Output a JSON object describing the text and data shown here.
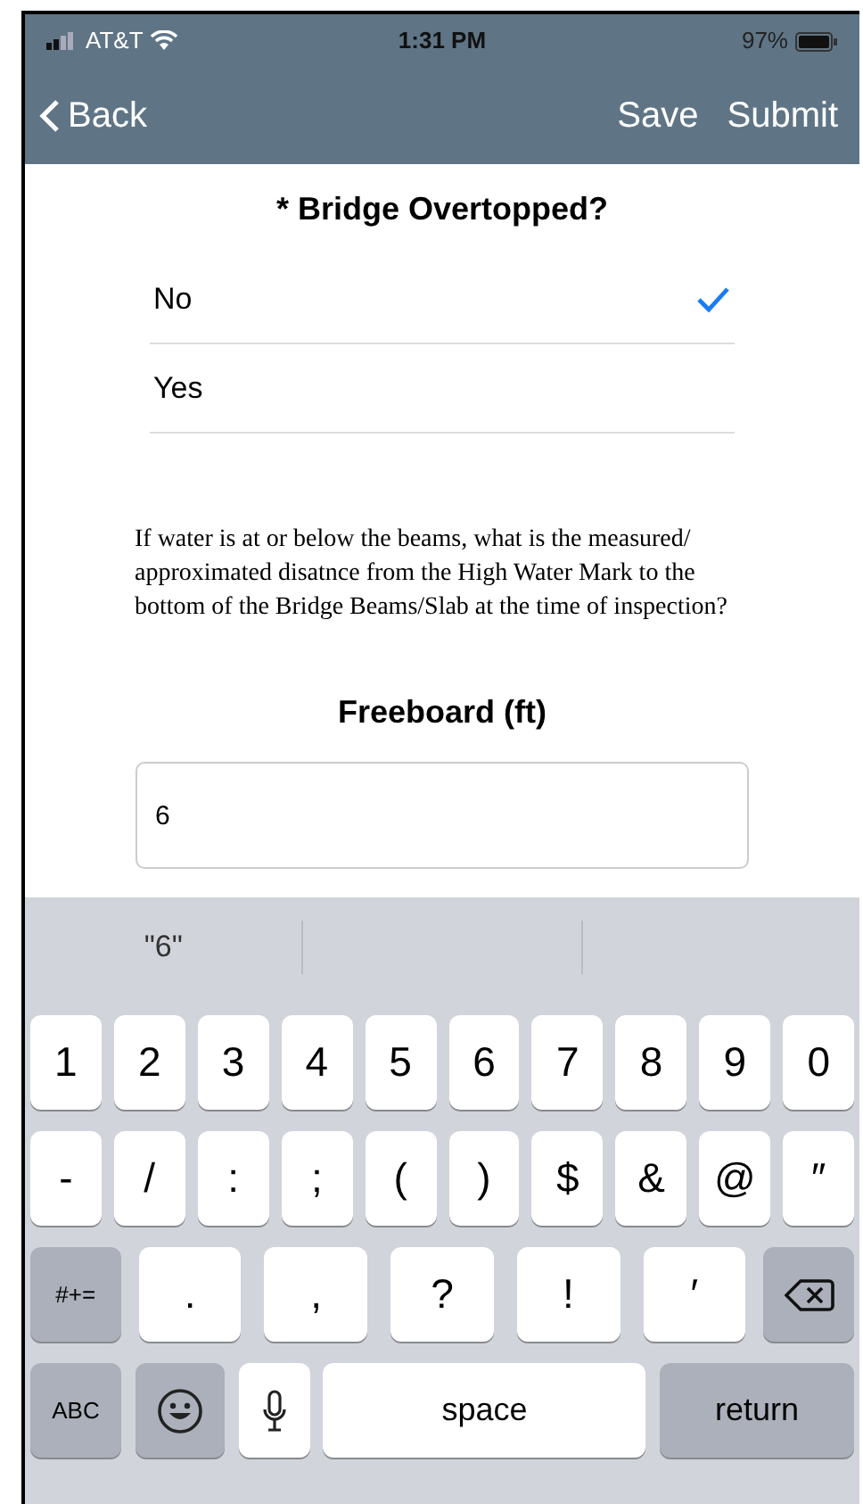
{
  "status_bar": {
    "carrier": "AT&T",
    "time": "1:31 PM",
    "battery": "97%"
  },
  "nav": {
    "back": "Back",
    "actions": [
      "Save",
      "Submit"
    ]
  },
  "question": {
    "title": "* Bridge Overtopped?",
    "options": [
      {
        "label": "No",
        "selected": true
      },
      {
        "label": "Yes",
        "selected": false
      }
    ]
  },
  "help_text": "If water is at or below the beams, what is the measured/ approximated disatnce from the High Water Mark to the bottom of the Bridge Beams/Slab at the time of inspection?",
  "field": {
    "label": "Freeboard (ft)",
    "value": "6"
  },
  "keyboard": {
    "suggestions": [
      "\"6\""
    ],
    "number_row": [
      {
        "kind": "char",
        "label": "1"
      },
      {
        "kind": "char",
        "label": "2"
      },
      {
        "kind": "char",
        "label": "3"
      },
      {
        "kind": "char",
        "label": "4"
      },
      {
        "kind": "char",
        "label": "5"
      },
      {
        "kind": "char",
        "label": "6"
      },
      {
        "kind": "char",
        "label": "7"
      },
      {
        "kind": "char",
        "label": "8"
      },
      {
        "kind": "char",
        "label": "9"
      },
      {
        "kind": "char",
        "label": "0"
      }
    ],
    "symbol_row": [
      {
        "kind": "char",
        "label": "-"
      },
      {
        "kind": "char",
        "label": "/"
      },
      {
        "kind": "char",
        "label": ":"
      },
      {
        "kind": "char",
        "label": ";"
      },
      {
        "kind": "char",
        "label": "("
      },
      {
        "kind": "char",
        "label": ")"
      },
      {
        "kind": "char",
        "label": "$"
      },
      {
        "kind": "char",
        "label": "&"
      },
      {
        "kind": "char",
        "label": "@"
      },
      {
        "kind": "char",
        "label": "″"
      }
    ],
    "punctuation_row": [
      {
        "kind": "function",
        "label": "#+="
      },
      {
        "kind": "wide",
        "label": "."
      },
      {
        "kind": "wide",
        "label": ","
      },
      {
        "kind": "wide",
        "label": "?"
      },
      {
        "kind": "wide",
        "label": "!"
      },
      {
        "kind": "wide",
        "label": "′"
      },
      {
        "kind": "delete"
      }
    ],
    "bottom_row": [
      {
        "kind": "function",
        "label": "ABC"
      },
      {
        "kind": "emoji"
      },
      {
        "kind": "mic"
      },
      {
        "kind": "space",
        "label": "space"
      },
      {
        "kind": "return",
        "label": "return"
      }
    ]
  }
}
